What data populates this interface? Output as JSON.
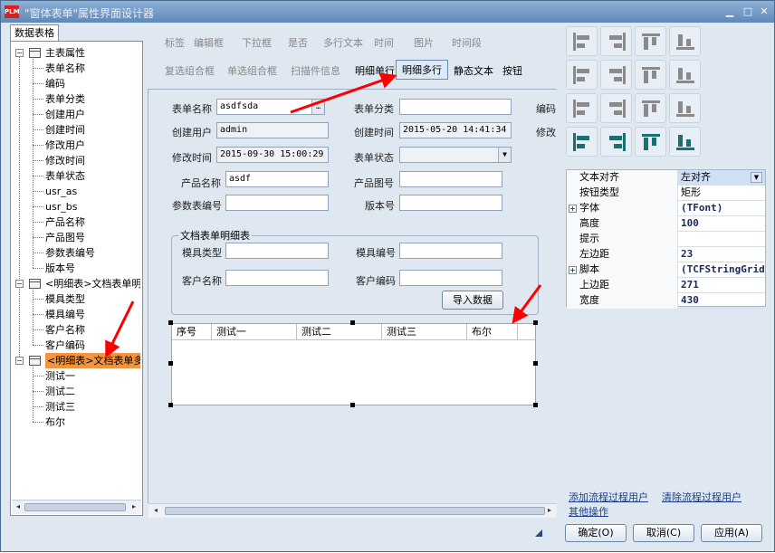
{
  "window": {
    "title": "\"窗体表单\"属性界面设计器",
    "logo": "PLM"
  },
  "left": {
    "tab": "数据表格",
    "tree": [
      {
        "label": "主表属性",
        "level": 0,
        "kind": "table"
      },
      {
        "label": "表单名称",
        "level": 1
      },
      {
        "label": "编码",
        "level": 1
      },
      {
        "label": "表单分类",
        "level": 1
      },
      {
        "label": "创建用户",
        "level": 1
      },
      {
        "label": "创建时间",
        "level": 1
      },
      {
        "label": "修改用户",
        "level": 1
      },
      {
        "label": "修改时间",
        "level": 1
      },
      {
        "label": "表单状态",
        "level": 1
      },
      {
        "label": "usr_as",
        "level": 1
      },
      {
        "label": "usr_bs",
        "level": 1
      },
      {
        "label": "产品名称",
        "level": 1
      },
      {
        "label": "产品图号",
        "level": 1
      },
      {
        "label": "参数表编号",
        "level": 1
      },
      {
        "label": "版本号",
        "level": 1
      },
      {
        "label": "<明细表>文档表单明",
        "level": 0,
        "kind": "table"
      },
      {
        "label": "模具类型",
        "level": 1
      },
      {
        "label": "模具编号",
        "level": 1
      },
      {
        "label": "客户名称",
        "level": 1
      },
      {
        "label": "客户编码",
        "level": 1
      },
      {
        "label": "<明细表>文档表单多",
        "level": 0,
        "kind": "table",
        "selected": true
      },
      {
        "label": "测试一",
        "level": 1
      },
      {
        "label": "测试二",
        "level": 1
      },
      {
        "label": "测试三",
        "level": 1
      },
      {
        "label": "布尔",
        "level": 1
      }
    ]
  },
  "toolbar": {
    "row1": [
      "标签",
      "编辑框",
      "下拉框",
      "是否",
      "多行文本",
      "时间",
      "图片",
      "时间段"
    ],
    "row2": [
      "复选组合框",
      "单选组合框",
      "扫描件信息",
      "明细单行",
      "明细多行",
      "静态文本",
      "按钮"
    ],
    "active": "明细多行"
  },
  "form": {
    "labels": {
      "form_name": "表单名称",
      "form_category": "表单分类",
      "code": "编码",
      "creator": "创建用户",
      "created_at": "创建时间",
      "modifier": "修改",
      "modified_at": "修改时间",
      "form_status": "表单状态",
      "product_name": "产品名称",
      "product_drawing": "产品图号",
      "param_no": "参数表编号",
      "version": "版本号"
    },
    "values": {
      "form_name": "asdfsda",
      "creator": "admin",
      "created_at": "2015-05-20 14:41:34",
      "modified_at": "2015-09-30 15:00:29",
      "product_name": "asdf"
    },
    "group": {
      "title": "文档表单明细表",
      "labels": {
        "mold_type": "模具类型",
        "mold_no": "模具编号",
        "customer_name": "客户名称",
        "customer_code": "客户编码"
      },
      "import_button": "导入数据"
    },
    "grid_columns": [
      "序号",
      "测试一",
      "测试二",
      "测试三",
      "布尔"
    ]
  },
  "properties": [
    {
      "key": "文本对齐",
      "value": "左对齐",
      "selected": true,
      "dropdown": true
    },
    {
      "key": "按钮类型",
      "value": "矩形"
    },
    {
      "key": "字体",
      "value": "(TFont)",
      "expandable": true
    },
    {
      "key": "高度",
      "value": "100"
    },
    {
      "key": "提示",
      "value": ""
    },
    {
      "key": "左边距",
      "value": "23"
    },
    {
      "key": "脚本",
      "value": "(TCFStringGrid",
      "expandable": true
    },
    {
      "key": "上边距",
      "value": "271"
    },
    {
      "key": "宽度",
      "value": "430"
    }
  ],
  "links": {
    "add_process_user": "添加流程过程用户",
    "clear_process_user": "清除流程过程用户",
    "other_ops": "其他操作"
  },
  "footer": {
    "ok": "确定(O)",
    "cancel": "取消(C)",
    "apply": "应用(A)"
  },
  "icons": [
    "align-left-icon",
    "align-right-icon",
    "align-top-icon",
    "align-bottom-icon",
    "center-horizontal-icon",
    "center-vertical-icon",
    "same-width-icon",
    "same-height-icon",
    "space-horizontal-icon",
    "space-vertical-icon",
    "equal-size-icon",
    "distribute-icon",
    "move-left-icon",
    "move-right-icon",
    "move-up-icon",
    "move-down-icon"
  ],
  "colors": {
    "selection": "#f3953f",
    "title_bar": "#5f88b8",
    "annotation_arrow": "#ff0000"
  }
}
